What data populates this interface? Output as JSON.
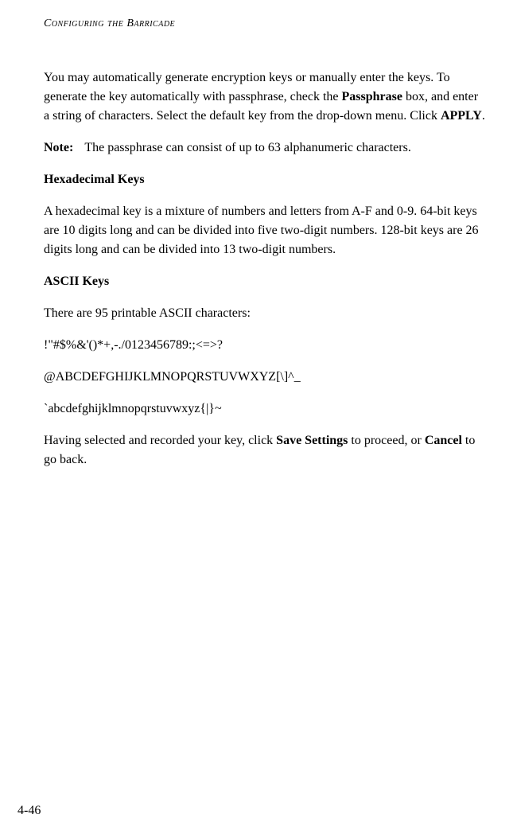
{
  "runningHead": "Configuring the Barricade",
  "p1_a": "You may automatically generate encryption keys or manually enter the keys. To generate the key automatically with passphrase, check the ",
  "p1_bold1": "Passphrase",
  "p1_b": " box, and enter a string of characters. Select the default key from the drop-down menu. Click ",
  "p1_bold2": "APPLY",
  "p1_c": ".",
  "noteLabel": "Note:",
  "noteText": "The passphrase can consist of up to 63 alphanumeric characters.",
  "h1": "Hexadecimal Keys",
  "p2": "A hexadecimal key is a mixture of numbers and letters from A-F and 0-9. 64-bit keys are 10 digits long and can be divided into five two-digit numbers. 128-bit keys are 26 digits long and can be divided into 13 two-digit numbers.",
  "h2": "ASCII Keys",
  "p3": "There are 95 printable ASCII characters:",
  "p4": "!\"#$%&'()*+,-./0123456789:;<=>?",
  "p5": "@ABCDEFGHIJKLMNOPQRSTUVWXYZ[\\]^_",
  "p6": "`abcdefghijklmnopqrstuvwxyz{|}~",
  "p7_a": "Having selected and recorded your key, click ",
  "p7_bold1": "Save Settings",
  "p7_b": " to proceed, or ",
  "p7_bold2": "Cancel",
  "p7_c": " to go back.",
  "pageNumber": "4-46"
}
